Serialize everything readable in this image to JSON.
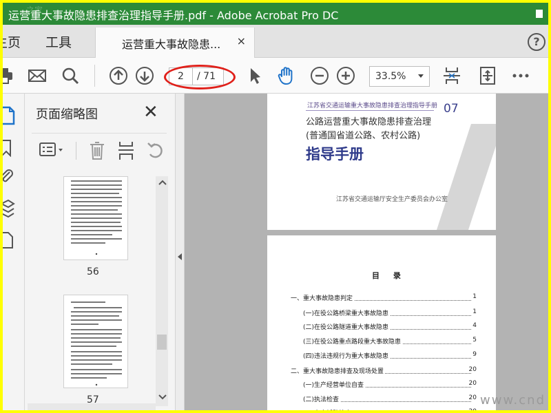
{
  "window": {
    "title": "运营重大事故隐患排查治理指导手册.pdf - Adobe Acrobat Pro DC"
  },
  "tabs": {
    "home": "主页",
    "tools": "工具",
    "document": "运营重大事故隐患...",
    "close_glyph": "×",
    "help_glyph": "?"
  },
  "toolbar": {
    "page_current": "2",
    "page_total": "/ 71",
    "zoom": "33.5%",
    "icons": [
      "print-icon",
      "mail-icon",
      "search-icon",
      "prev-page-icon",
      "next-page-icon",
      "select-cursor-icon",
      "hand-tool-icon",
      "zoom-out-icon",
      "zoom-in-icon",
      "page-fit-icon",
      "page-scroll-icon",
      "more-icon"
    ],
    "accent_color": "#1f73c9",
    "annotation_color": "#e0201a"
  },
  "sidebar": {
    "title": "页面缩略图",
    "close_glyph": "✕",
    "thumbnails": [
      {
        "number": "56"
      },
      {
        "number": "57"
      }
    ]
  },
  "document": {
    "cover": {
      "header": "江苏省交通运输重大事故隐患排查治理指导手册",
      "number": "07",
      "line1": "公路运营重大事故隐患排查治理",
      "line2": "(普通国省道公路、农村公路)",
      "title": "指导手册",
      "org": "江苏省交通运输厅安全生产委员会办公室"
    },
    "toc": {
      "title": "目 录",
      "entries": [
        {
          "text": "一、重大事故隐患判定",
          "page": "1",
          "indent": 0
        },
        {
          "text": "(一)在役公路桥梁重大事故隐患",
          "page": "1",
          "indent": 1
        },
        {
          "text": "(二)在役公路隧道重大事故隐患",
          "page": "4",
          "indent": 1
        },
        {
          "text": "(三)在役公路重点路段重大事故隐患",
          "page": "5",
          "indent": 1
        },
        {
          "text": "(四)违法违规行为重大事故隐患",
          "page": "9",
          "indent": 1
        },
        {
          "text": "二、重大事故隐患排查及现场处置",
          "page": "20",
          "indent": 0
        },
        {
          "text": "(一)生产经营单位自查",
          "page": "20",
          "indent": 1
        },
        {
          "text": "(二)执法检查",
          "page": "20",
          "indent": 1
        },
        {
          "text": "(三)专家辅助检查",
          "page": "20",
          "indent": 1
        }
      ]
    }
  },
  "watermark": {
    "top_left": "之家",
    "bottom_right": "www.cnd"
  },
  "colors": {
    "titlebar": "#2c8a38",
    "border_highlight": "#ffff00",
    "doc_background": "#b3b3b3"
  }
}
